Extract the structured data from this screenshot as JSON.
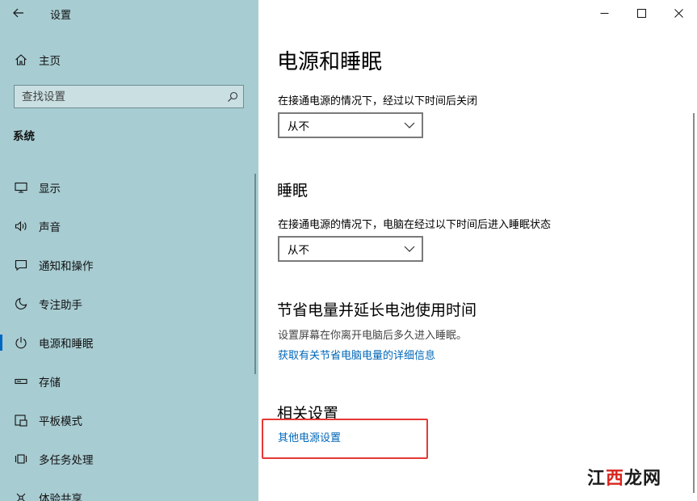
{
  "app": {
    "title": "设置"
  },
  "sidebar": {
    "home_label": "主页",
    "search_placeholder": "查找设置",
    "section": "系统",
    "items": [
      {
        "label": "显示",
        "icon": "monitor-icon"
      },
      {
        "label": "声音",
        "icon": "speaker-icon"
      },
      {
        "label": "通知和操作",
        "icon": "notification-icon"
      },
      {
        "label": "专注助手",
        "icon": "moon-icon"
      },
      {
        "label": "电源和睡眠",
        "icon": "power-icon",
        "selected": true
      },
      {
        "label": "存储",
        "icon": "storage-icon"
      },
      {
        "label": "平板模式",
        "icon": "tablet-icon"
      },
      {
        "label": "多任务处理",
        "icon": "multitask-icon"
      },
      {
        "label": "体验共享",
        "icon": "share-icon"
      }
    ]
  },
  "main": {
    "title": "电源和睡眠",
    "screen": {
      "label": "在接通电源的情况下，经过以下时间后关闭",
      "value": "从不"
    },
    "sleep": {
      "heading": "睡眠",
      "label": "在接通电源的情况下，电脑在经过以下时间后进入睡眠状态",
      "value": "从不"
    },
    "battery": {
      "heading": "节省电量并延长电池使用时间",
      "desc": "设置屏幕在你离开电脑后多久进入睡眠。",
      "link": "获取有关节省电脑电量的详细信息"
    },
    "related": {
      "heading": "相关设置",
      "link": "其他电源设置"
    }
  },
  "watermark": {
    "prefix": "江",
    "mid": "西",
    "suffix": "龙网"
  },
  "colors": {
    "sidebar_bg": "#a7ccd2",
    "accent": "#0067c0",
    "link": "#0067b8",
    "highlight": "#e53935"
  }
}
